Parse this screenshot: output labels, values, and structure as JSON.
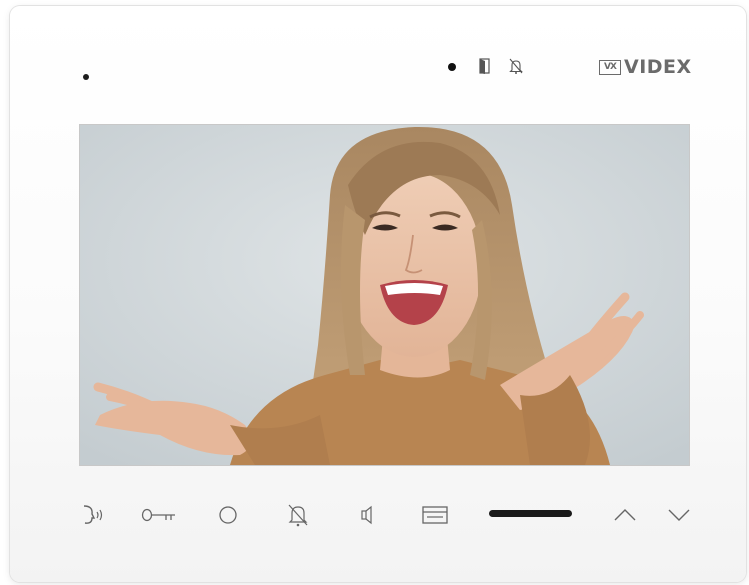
{
  "device": {
    "brand": "VIDEX",
    "logo_mark": "VX"
  },
  "indicators": [
    {
      "icon": "status-led-icon"
    },
    {
      "icon": "door-open-icon"
    },
    {
      "icon": "mute-bell-icon"
    }
  ],
  "screen": {
    "content": "caller-video-feed"
  },
  "buttons": [
    {
      "name": "talk-button",
      "icon": "speech-icon"
    },
    {
      "name": "door-release-button",
      "icon": "key-icon"
    },
    {
      "name": "auxiliary-button",
      "icon": "circle-icon"
    },
    {
      "name": "mute-button",
      "icon": "bell-mute-icon"
    },
    {
      "name": "volume-button",
      "icon": "speaker-icon"
    },
    {
      "name": "menu-button",
      "icon": "menu-icon"
    },
    {
      "name": "up-button",
      "icon": "chevron-up-icon"
    },
    {
      "name": "down-button",
      "icon": "chevron-down-icon"
    }
  ],
  "colors": {
    "housing": "#ffffff",
    "icon": "#6b6b6b",
    "logo": "#6b6b6b",
    "screen_background": "#cfd6d9"
  }
}
